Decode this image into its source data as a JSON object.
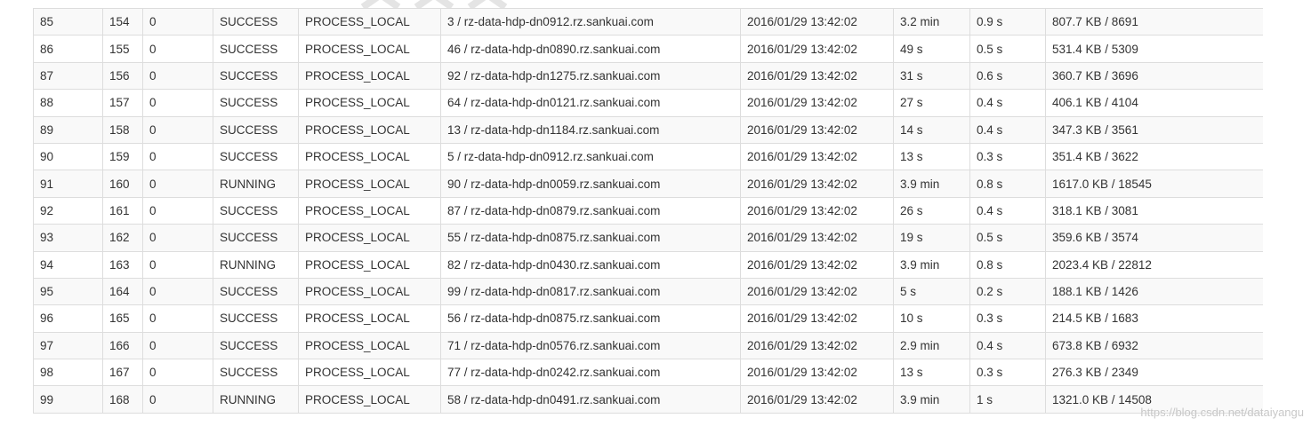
{
  "table": {
    "rows": [
      [
        "85",
        "154",
        "0",
        "SUCCESS",
        "PROCESS_LOCAL",
        "3 / rz-data-hdp-dn0912.rz.sankuai.com",
        "2016/01/29 13:42:02",
        "3.2 min",
        "0.9 s",
        "807.7 KB / 8691"
      ],
      [
        "86",
        "155",
        "0",
        "SUCCESS",
        "PROCESS_LOCAL",
        "46 / rz-data-hdp-dn0890.rz.sankuai.com",
        "2016/01/29 13:42:02",
        "49 s",
        "0.5 s",
        "531.4 KB / 5309"
      ],
      [
        "87",
        "156",
        "0",
        "SUCCESS",
        "PROCESS_LOCAL",
        "92 / rz-data-hdp-dn1275.rz.sankuai.com",
        "2016/01/29 13:42:02",
        "31 s",
        "0.6 s",
        "360.7 KB / 3696"
      ],
      [
        "88",
        "157",
        "0",
        "SUCCESS",
        "PROCESS_LOCAL",
        "64 / rz-data-hdp-dn0121.rz.sankuai.com",
        "2016/01/29 13:42:02",
        "27 s",
        "0.4 s",
        "406.1 KB / 4104"
      ],
      [
        "89",
        "158",
        "0",
        "SUCCESS",
        "PROCESS_LOCAL",
        "13 / rz-data-hdp-dn1184.rz.sankuai.com",
        "2016/01/29 13:42:02",
        "14 s",
        "0.4 s",
        "347.3 KB / 3561"
      ],
      [
        "90",
        "159",
        "0",
        "SUCCESS",
        "PROCESS_LOCAL",
        "5 / rz-data-hdp-dn0912.rz.sankuai.com",
        "2016/01/29 13:42:02",
        "13 s",
        "0.3 s",
        "351.4 KB / 3622"
      ],
      [
        "91",
        "160",
        "0",
        "RUNNING",
        "PROCESS_LOCAL",
        "90 / rz-data-hdp-dn0059.rz.sankuai.com",
        "2016/01/29 13:42:02",
        "3.9 min",
        "0.8 s",
        "1617.0 KB / 18545"
      ],
      [
        "92",
        "161",
        "0",
        "SUCCESS",
        "PROCESS_LOCAL",
        "87 / rz-data-hdp-dn0879.rz.sankuai.com",
        "2016/01/29 13:42:02",
        "26 s",
        "0.4 s",
        "318.1 KB / 3081"
      ],
      [
        "93",
        "162",
        "0",
        "SUCCESS",
        "PROCESS_LOCAL",
        "55 / rz-data-hdp-dn0875.rz.sankuai.com",
        "2016/01/29 13:42:02",
        "19 s",
        "0.5 s",
        "359.6 KB / 3574"
      ],
      [
        "94",
        "163",
        "0",
        "RUNNING",
        "PROCESS_LOCAL",
        "82 / rz-data-hdp-dn0430.rz.sankuai.com",
        "2016/01/29 13:42:02",
        "3.9 min",
        "0.8 s",
        "2023.4 KB / 22812"
      ],
      [
        "95",
        "164",
        "0",
        "SUCCESS",
        "PROCESS_LOCAL",
        "99 / rz-data-hdp-dn0817.rz.sankuai.com",
        "2016/01/29 13:42:02",
        "5 s",
        "0.2 s",
        "188.1 KB / 1426"
      ],
      [
        "96",
        "165",
        "0",
        "SUCCESS",
        "PROCESS_LOCAL",
        "56 / rz-data-hdp-dn0875.rz.sankuai.com",
        "2016/01/29 13:42:02",
        "10 s",
        "0.3 s",
        "214.5 KB / 1683"
      ],
      [
        "97",
        "166",
        "0",
        "SUCCESS",
        "PROCESS_LOCAL",
        "71 / rz-data-hdp-dn0576.rz.sankuai.com",
        "2016/01/29 13:42:02",
        "2.9 min",
        "0.4 s",
        "673.8 KB / 6932"
      ],
      [
        "98",
        "167",
        "0",
        "SUCCESS",
        "PROCESS_LOCAL",
        "77 / rz-data-hdp-dn0242.rz.sankuai.com",
        "2016/01/29 13:42:02",
        "13 s",
        "0.3 s",
        "276.3 KB / 2349"
      ],
      [
        "99",
        "168",
        "0",
        "RUNNING",
        "PROCESS_LOCAL",
        "58 / rz-data-hdp-dn0491.rz.sankuai.com",
        "2016/01/29 13:42:02",
        "3.9 min",
        "1 s",
        "1321.0 KB / 14508"
      ]
    ]
  },
  "watermark": {
    "text": "https://blog.csdn.net/dataiyangu"
  },
  "colors": {
    "row_stripe": "#f9f9f9",
    "border": "#dddddd",
    "text": "#333333",
    "watermark": "#c8c8c8"
  }
}
